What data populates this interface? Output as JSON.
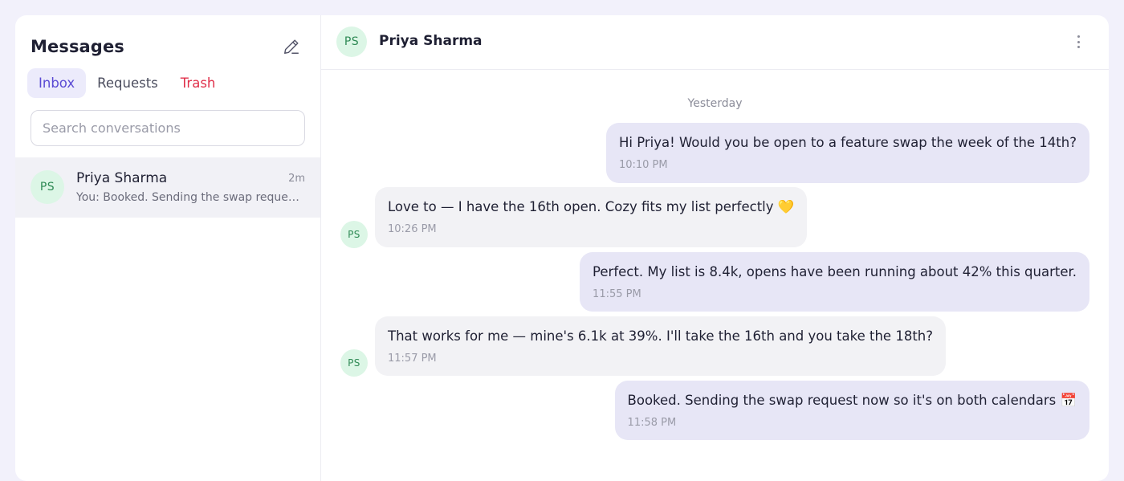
{
  "sidebar": {
    "title": "Messages",
    "compose_icon": "pencil-icon",
    "tabs": [
      {
        "label": "Inbox",
        "active": true
      },
      {
        "label": "Requests",
        "active": false
      },
      {
        "label": "Trash",
        "active": false
      }
    ],
    "search": {
      "placeholder": "Search conversations",
      "value": ""
    },
    "conversations": [
      {
        "initials": "PS",
        "name": "Priya Sharma",
        "time": "2m",
        "preview": "You: Booked. Sending the swap request now so it's on both calendars 📅",
        "selected": true
      }
    ]
  },
  "chat": {
    "contact": {
      "initials": "PS",
      "name": "Priya Sharma"
    },
    "menu_icon": "more-vertical-icon",
    "day_separator": "Yesterday",
    "messages": [
      {
        "direction": "out",
        "text": "Hi Priya! Would you be open to a feature swap the week of the 14th?",
        "time": "10:10 PM"
      },
      {
        "direction": "in",
        "text": "Love to — I have the 16th open. Cozy fits my list perfectly 💛",
        "time": "10:26 PM",
        "avatar": "PS"
      },
      {
        "direction": "out",
        "text": "Perfect. My list is 8.4k, opens have been running about 42% this quarter.",
        "time": "11:55 PM"
      },
      {
        "direction": "in",
        "text": "That works for me — mine's 6.1k at 39%. I'll take the 16th and you take the 18th?",
        "time": "11:57 PM",
        "avatar": "PS"
      },
      {
        "direction": "out",
        "text": "Booked. Sending the swap request now so it's on both calendars 📅",
        "time": "11:58 PM"
      }
    ]
  },
  "colors": {
    "accent": "#5b4bd4",
    "danger": "#e0304a",
    "avatar_bg": "#dcf6e6",
    "avatar_text": "#2f8a55",
    "outgoing_bubble": "#e7e6f6",
    "incoming_bubble": "#f2f2f5"
  }
}
